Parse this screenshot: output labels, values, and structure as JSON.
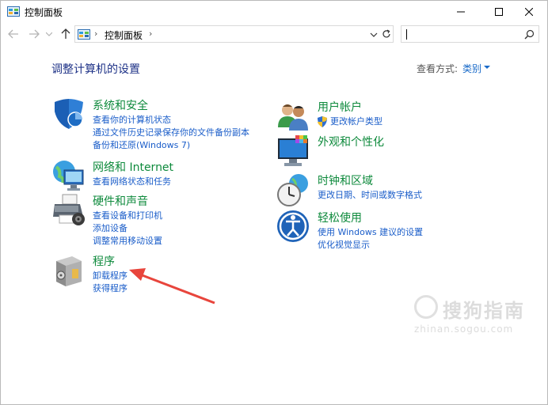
{
  "window": {
    "title": "控制面板"
  },
  "addressbar": {
    "breadcrumb": "控制面板",
    "separator": "›"
  },
  "search": {
    "value": "",
    "placeholder": ""
  },
  "main": {
    "heading": "调整计算机的设置",
    "view_by_label": "查看方式:",
    "view_by_value": "类别"
  },
  "categories": [
    {
      "title": "系统和安全",
      "icon": "shield-icon",
      "links": [
        "查看你的计算机状态",
        "通过文件历史记录保存你的文件备份副本",
        "备份和还原(Windows 7)"
      ]
    },
    {
      "title": "网络和 Internet",
      "icon": "network-globe-icon",
      "links": [
        "查看网络状态和任务"
      ]
    },
    {
      "title": "硬件和声音",
      "icon": "printer-icon",
      "links": [
        "查看设备和打印机",
        "添加设备",
        "调整常用移动设置"
      ]
    },
    {
      "title": "程序",
      "icon": "programs-box-icon",
      "links": [
        "卸载程序",
        "获得程序"
      ]
    },
    {
      "title": "用户帐户",
      "icon": "users-icon",
      "links": [
        "更改帐户类型"
      ]
    },
    {
      "title": "外观和个性化",
      "icon": "monitor-palette-icon",
      "links": []
    },
    {
      "title": "时钟和区域",
      "icon": "clock-globe-icon",
      "links": [
        "更改日期、时间或数字格式"
      ]
    },
    {
      "title": "轻松使用",
      "icon": "ease-of-access-icon",
      "links": [
        "使用 Windows 建议的设置",
        "优化视觉显示"
      ]
    }
  ],
  "watermark": {
    "text": "搜狗指南",
    "url": "zhinan.sogou.com"
  },
  "colors": {
    "category_title": "#0e8a3c",
    "link": "#1a5dc9",
    "heading": "#1e3287",
    "annotation_arrow": "#e8453c"
  }
}
